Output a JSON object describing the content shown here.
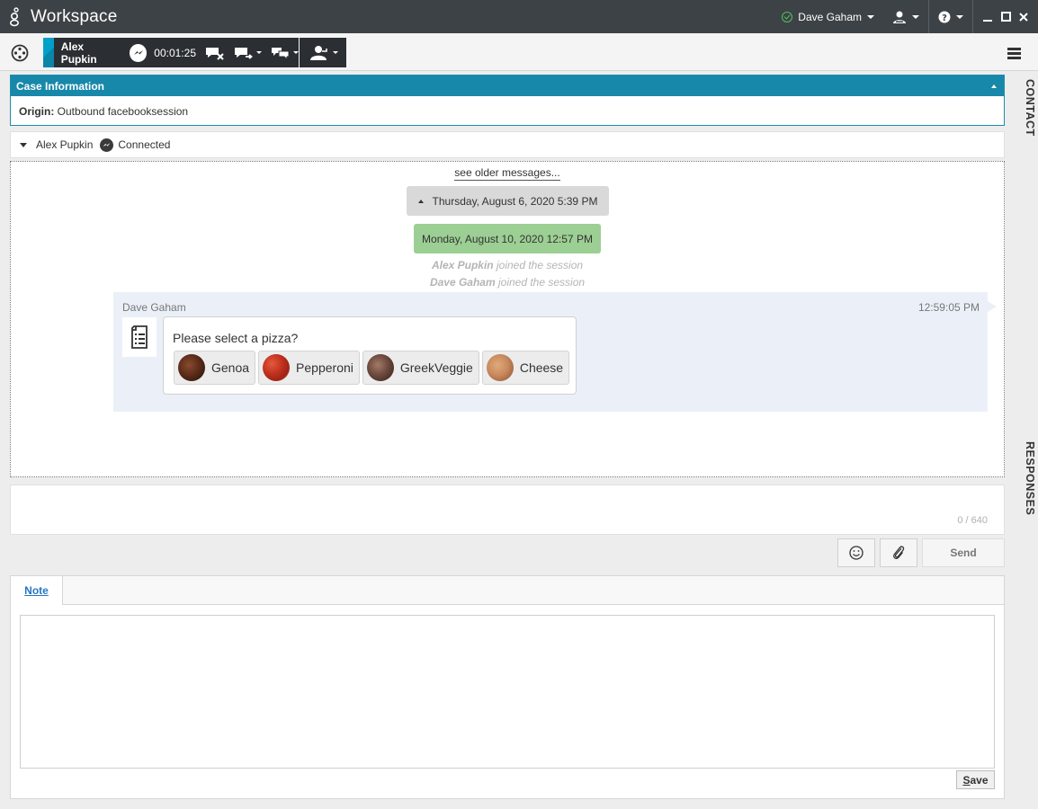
{
  "titlebar": {
    "app_title": "Workspace",
    "user_name": "Dave Gaham",
    "status_color": "#4fc35a",
    "icons": [
      "genesys-logo-icon",
      "status-ok-icon",
      "agent-icon",
      "help-icon",
      "minimize-icon",
      "maximize-icon",
      "close-icon"
    ]
  },
  "toolbar": {
    "contact_name": "Alex Pupkin",
    "timer": "00:01:25",
    "icons": [
      "wheel-icon",
      "messenger-icon",
      "end-chat-icon",
      "transfer-chat-icon",
      "conference-chat-icon",
      "consult-agent-icon",
      "hamburger-icon"
    ]
  },
  "case": {
    "header": "Case Information",
    "origin_label": "Origin:",
    "origin_value": "Outbound facebooksession"
  },
  "side_tabs": {
    "contact": "CONTACT",
    "responses": "RESPONSES"
  },
  "party": {
    "name": "Alex Pupkin",
    "status": "Connected"
  },
  "transcript": {
    "older_link": "see older messages...",
    "date_old": "Thursday, August 6, 2020 5:39 PM",
    "date_new": "Monday, August 10, 2020 12:57 PM",
    "joined_1_name": "Alex Pupkin",
    "joined_1_text": " joined the session",
    "joined_2_name": "Dave Gaham",
    "joined_2_text": " joined the session",
    "message": {
      "author": "Dave Gaham",
      "time": "12:59:05 PM",
      "question": "Please select a pizza?",
      "options": [
        {
          "label": "Genoa",
          "color": "#6b3a25"
        },
        {
          "label": "Pepperoni",
          "color": "#c9402e"
        },
        {
          "label": "GreekVeggie",
          "color": "#7a5448"
        },
        {
          "label": "Cheese",
          "color": "#c98a5e"
        }
      ]
    }
  },
  "composer": {
    "char_count": "0 / 640",
    "send_label": "Send"
  },
  "note": {
    "tab_label": "Note",
    "save_label": "Save"
  }
}
